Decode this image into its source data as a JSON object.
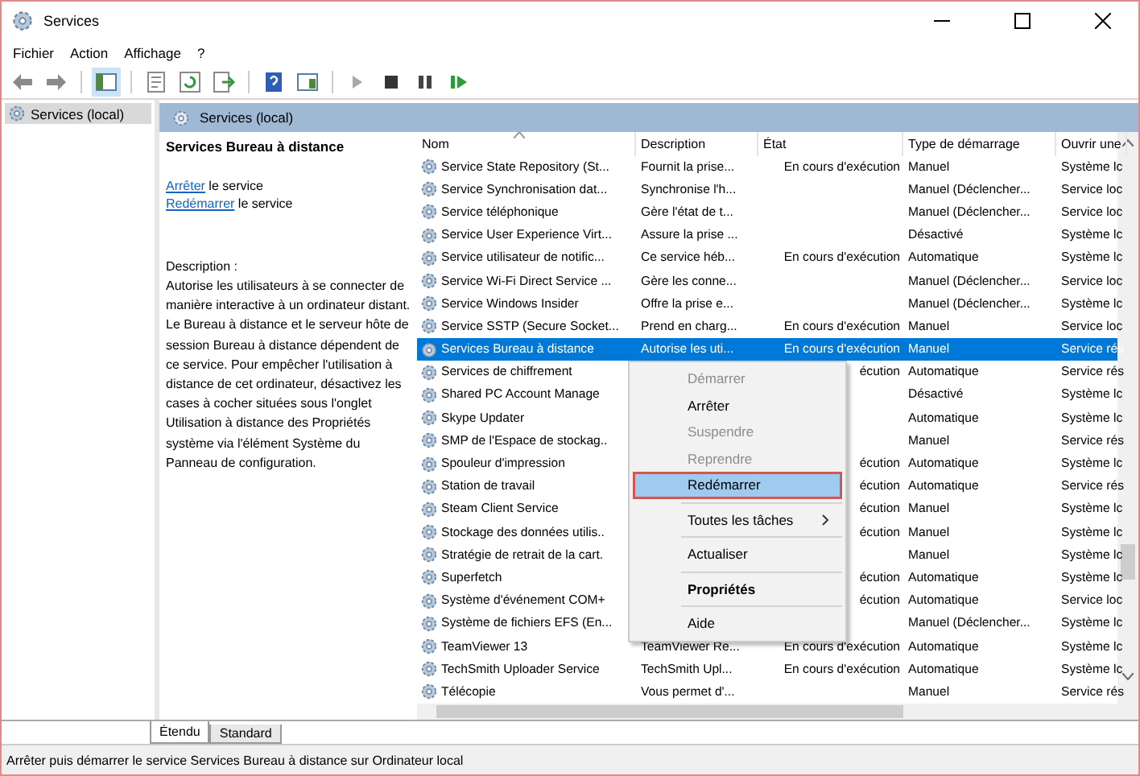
{
  "window": {
    "title": "Services"
  },
  "menu_bar": [
    "Fichier",
    "Action",
    "Affichage",
    "?"
  ],
  "tree": [
    {
      "label": "Services (local)",
      "selected": true
    }
  ],
  "panel_header": "Services (local)",
  "details": {
    "title": "Services Bureau à distance",
    "actions": [
      {
        "link": "Arrêter",
        "text": " le service"
      },
      {
        "link": "Redémarrer",
        "text": " le service"
      }
    ],
    "description_label": "Description :",
    "description": "Autorise les utilisateurs à se connecter de manière interactive à un ordinateur distant. Le Bureau à distance et le serveur hôte de session Bureau à distance dépendent de ce service. Pour empêcher l'utilisation à distance de cet ordinateur, désactivez les cases à cocher situées sous l'onglet Utilisation à distance des Propriétés système via l'élément Système du Panneau de configuration."
  },
  "table": {
    "columns": [
      "Nom",
      "Description",
      "État",
      "Type de démarrage",
      "Ouvrir une"
    ],
    "rows": [
      {
        "name": "Service State Repository (St...",
        "description": "Fournit la prise...",
        "state": "En cours d'exécution",
        "startup": "Manuel",
        "logon": "Système lc",
        "selected": false
      },
      {
        "name": "Service Synchronisation dat...",
        "description": "Synchronise l'h...",
        "startup": "Manuel (Déclencher...",
        "logon": "Service loc",
        "selected": false
      },
      {
        "name": "Service téléphonique",
        "description": "Gère l'état de t...",
        "startup": "Manuel (Déclencher...",
        "logon": "Service loc",
        "selected": false
      },
      {
        "name": "Service User Experience Virt...",
        "description": "Assure la prise ...",
        "startup": "Désactivé",
        "logon": "Système lc",
        "selected": false
      },
      {
        "name": "Service utilisateur de notific...",
        "description": "Ce service héb...",
        "state": "En cours d'exécution",
        "startup": "Automatique",
        "logon": "Système lc",
        "selected": false
      },
      {
        "name": "Service Wi-Fi Direct Service ...",
        "description": "Gère les conne...",
        "startup": "Manuel (Déclencher...",
        "logon": "Service loc",
        "selected": false
      },
      {
        "name": "Service Windows Insider",
        "description": "Offre la prise e...",
        "startup": "Manuel (Déclencher...",
        "logon": "Système lc",
        "selected": false
      },
      {
        "name": "Service SSTP (Secure Socket...",
        "description": "Prend en charg...",
        "state": "En cours d'exécution",
        "startup": "Manuel",
        "logon": "Service loc",
        "selected": false
      },
      {
        "name": "Services Bureau à distance",
        "description": "Autorise les uti...",
        "state": "En cours d'exécution",
        "startup": "Manuel",
        "logon": "Service rés",
        "selected": true
      },
      {
        "name": "Services de chiffrement",
        "state": "écution",
        "startup": "Automatique",
        "logon": "Service rés",
        "selected": false
      },
      {
        "name": "Shared PC Account Manage",
        "startup": "Désactivé",
        "logon": "Système lc",
        "selected": false
      },
      {
        "name": "Skype Updater",
        "startup": "Automatique",
        "logon": "Système lc",
        "selected": false
      },
      {
        "name": "SMP de l'Espace de stockag..",
        "startup": "Manuel",
        "logon": "Service rés",
        "selected": false
      },
      {
        "name": "Spouleur d'impression",
        "state": "écution",
        "startup": "Automatique",
        "logon": "Système lc",
        "selected": false
      },
      {
        "name": "Station de travail",
        "state": "écution",
        "startup": "Automatique",
        "logon": "Service rés",
        "selected": false
      },
      {
        "name": "Steam Client Service",
        "state": "écution",
        "startup": "Manuel",
        "logon": "Système lc",
        "selected": false
      },
      {
        "name": "Stockage des données utilis..",
        "state": "écution",
        "startup": "Manuel",
        "logon": "Système lc",
        "selected": false
      },
      {
        "name": "Stratégie de retrait de la cart.",
        "startup": "Manuel",
        "logon": "Système lc",
        "selected": false
      },
      {
        "name": "Superfetch",
        "state": "écution",
        "startup": "Automatique",
        "logon": "Système lc",
        "selected": false
      },
      {
        "name": "Système d'événement COM+",
        "state": "écution",
        "startup": "Automatique",
        "logon": "Service loc",
        "selected": false
      },
      {
        "name": "Système de fichiers EFS (En...",
        "startup": "Manuel (Déclencher...",
        "logon": "Système lc",
        "selected": false
      },
      {
        "name": "TeamViewer 13",
        "description": "TeamViewer Re...",
        "state": "En cours d'exécution",
        "startup": "Automatique",
        "logon": "Système lc",
        "selected": false
      },
      {
        "name": "TechSmith Uploader Service",
        "description": "TechSmith Upl...",
        "state": "En cours d'exécution",
        "startup": "Automatique",
        "logon": "Système lc",
        "selected": false
      },
      {
        "name": "Télécopie",
        "description": "Vous permet d'...",
        "startup": "Manuel",
        "logon": "Service rés",
        "selected": false
      }
    ]
  },
  "context_menu": [
    {
      "kind": "item",
      "label": "Démarrer",
      "disabled": true,
      "highlighted": false,
      "bold": false,
      "submenu": false
    },
    {
      "kind": "item",
      "label": "Arrêter",
      "disabled": false,
      "highlighted": false,
      "bold": false,
      "submenu": false
    },
    {
      "kind": "item",
      "label": "Suspendre",
      "disabled": true,
      "highlighted": false,
      "bold": false,
      "submenu": false
    },
    {
      "kind": "item",
      "label": "Reprendre",
      "disabled": true,
      "highlighted": false,
      "bold": false,
      "submenu": false
    },
    {
      "kind": "item",
      "label": "Redémarrer",
      "disabled": false,
      "highlighted": true,
      "bold": false,
      "submenu": false
    },
    {
      "kind": "separator"
    },
    {
      "kind": "item",
      "label": "Toutes les tâches",
      "disabled": false,
      "highlighted": false,
      "bold": false,
      "submenu": true
    },
    {
      "kind": "separator"
    },
    {
      "kind": "item",
      "label": "Actualiser",
      "disabled": false,
      "highlighted": false,
      "bold": false,
      "submenu": false
    },
    {
      "kind": "separator"
    },
    {
      "kind": "item",
      "label": "Propriétés",
      "disabled": false,
      "highlighted": false,
      "bold": true,
      "submenu": false
    },
    {
      "kind": "separator"
    },
    {
      "kind": "item",
      "label": "Aide",
      "disabled": false,
      "highlighted": false,
      "bold": false,
      "submenu": false
    }
  ],
  "view_tabs": [
    {
      "label": "Étendu",
      "selected": true
    },
    {
      "label": "Standard",
      "selected": false
    }
  ],
  "status_bar": "Arrêter puis démarrer le service Services Bureau à distance sur Ordinateur local"
}
